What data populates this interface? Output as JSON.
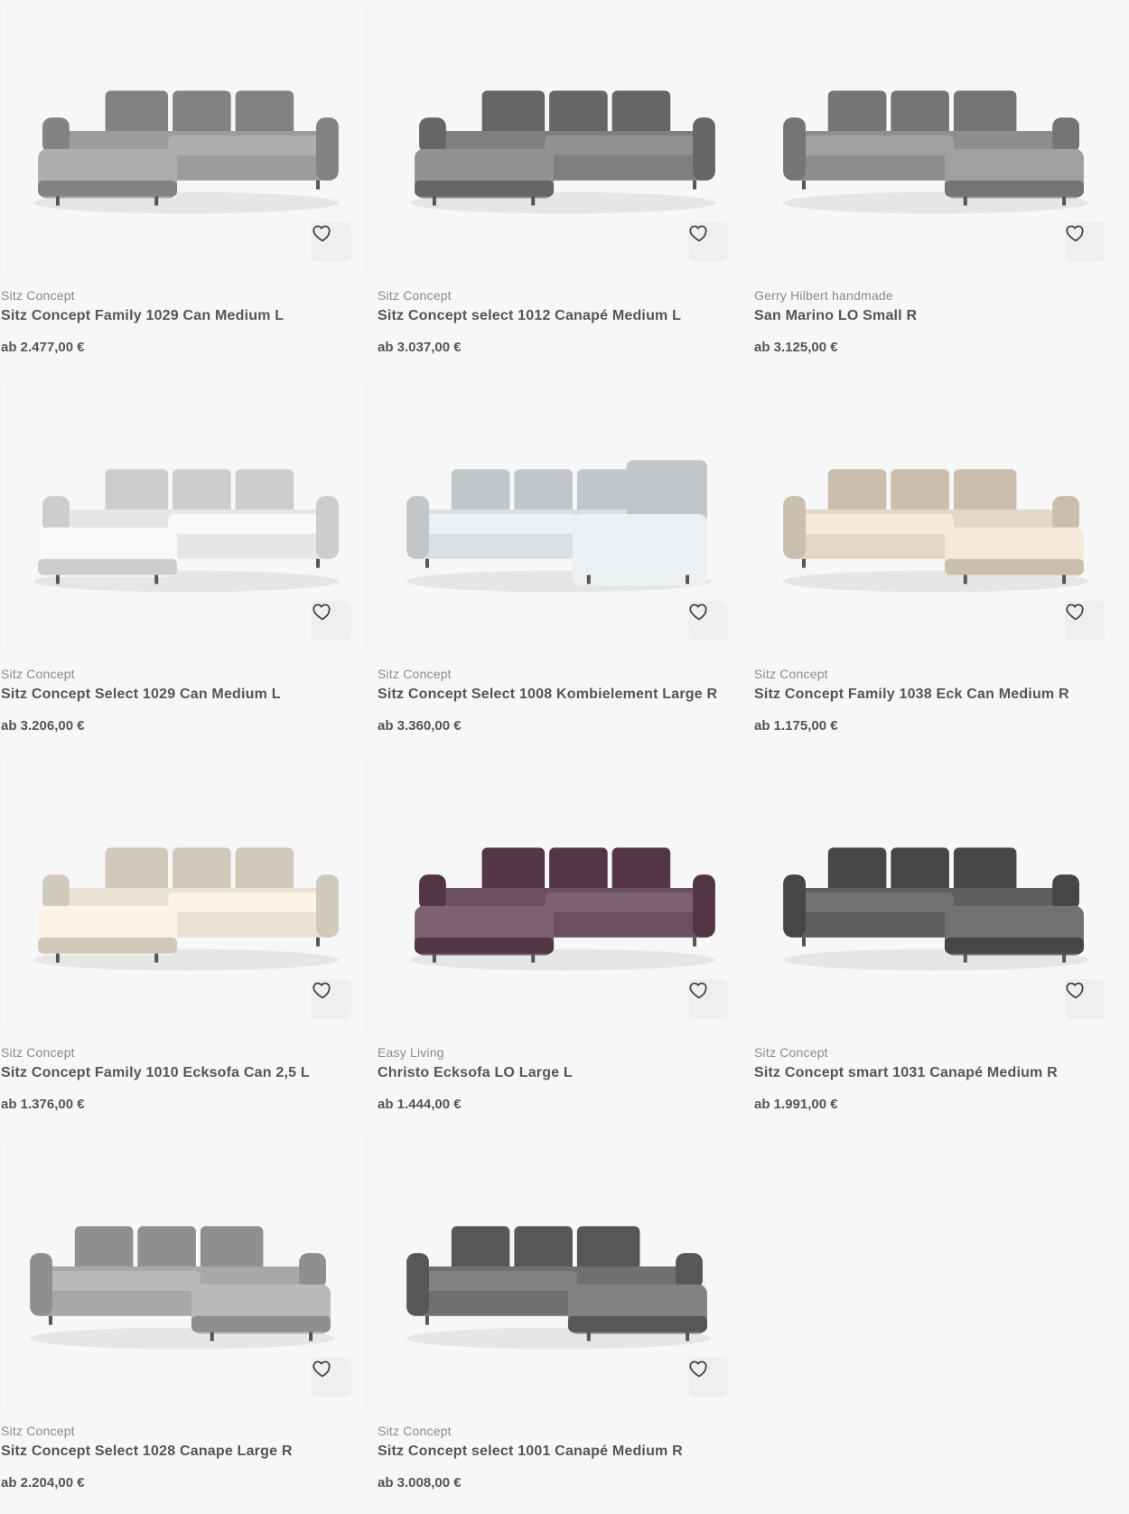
{
  "products": [
    {
      "brand": "Sitz Concept",
      "title": "Sitz Concept Family 1029 Can Medium L",
      "price": "ab 2.477,00 €",
      "color": "#9c9c9c",
      "shape": "chaise-left"
    },
    {
      "brand": "Sitz Concept",
      "title": "Sitz Concept select 1012 Canapé Medium L",
      "price": "ab 3.037,00 €",
      "color": "#7f7f7f",
      "shape": "chaise-left"
    },
    {
      "brand": "Gerry Hilbert handmade",
      "title": "San Marino LO Small R",
      "price": "ab 3.125,00 €",
      "color": "#8e8e8e",
      "shape": "chaise-right"
    },
    {
      "brand": "Sitz Concept",
      "title": "Sitz Concept Select 1029 Can Medium L",
      "price": "ab 3.206,00 €",
      "color": "#e6e6e6",
      "shape": "chaise-left"
    },
    {
      "brand": "Sitz Concept",
      "title": "Sitz Concept Select 1008 Kombielement Large R",
      "price": "ab 3.360,00 €",
      "color": "#dcdfe1",
      "shape": "corner-right"
    },
    {
      "brand": "Sitz Concept",
      "title": "Sitz Concept Family 1038 Eck Can Medium R",
      "price": "ab 1.175,00 €",
      "color": "#e3d8c8",
      "shape": "chaise-right"
    },
    {
      "brand": "Sitz Concept",
      "title": "Sitz Concept Family 1010 Ecksofa Can 2,5 L",
      "price": "ab 1.376,00 €",
      "color": "#e8e3d3",
      "shape": "chaise-left"
    },
    {
      "brand": "Easy Living",
      "title": "Christo Ecksofa LO Large L",
      "price": "ab 1.444,00 €",
      "color": "#6b4f5e",
      "shape": "chaise-left"
    },
    {
      "brand": "Sitz Concept",
      "title": "Sitz Concept smart 1031 Canapé Medium R",
      "price": "ab 1.991,00 €",
      "color": "#5f5f5f",
      "shape": "chaise-right"
    },
    {
      "brand": "Sitz Concept",
      "title": "Sitz Concept Select 1028 Canape Large R",
      "price": "ab 2.204,00 €",
      "color": "#a8a8a8",
      "shape": "chaise-right"
    },
    {
      "brand": "Sitz Concept",
      "title": "Sitz Concept select 1001 Canapé Medium R",
      "price": "ab 3.008,00 €",
      "color": "#6e7072",
      "shape": "chaise-right"
    }
  ],
  "icons": {
    "favorite": "heart-outline-icon"
  },
  "accent_color": "#e23f4b"
}
